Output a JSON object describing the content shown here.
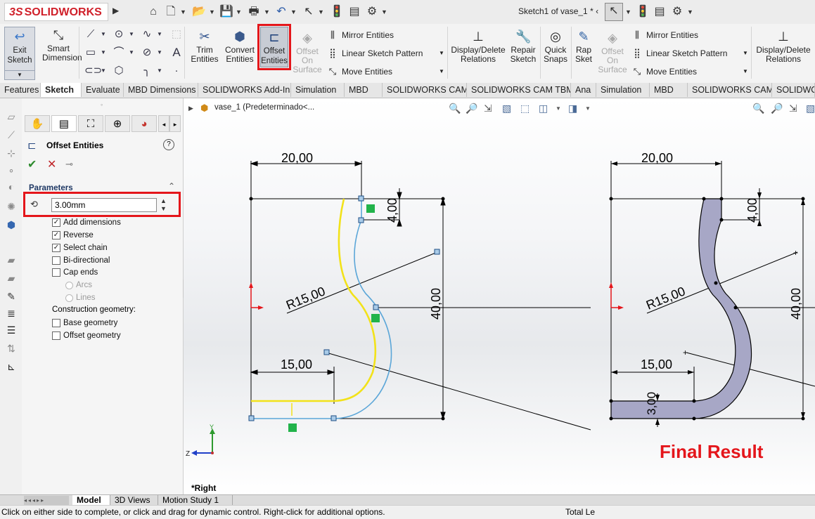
{
  "app": {
    "logo": "SOLIDWORKS",
    "logo_prefix": "3S",
    "document_title": "Sketch1 of vase_1 * ‹"
  },
  "ribbon": {
    "exit_sketch": "Exit\nSketch",
    "smart_dimension": "Smart\nDimension",
    "trim_entities": "Trim\nEntities",
    "convert_entities": "Convert\nEntities",
    "offset_entities": "Offset\nEntities",
    "offset_on_surface": "Offset\nOn\nSurface",
    "mirror_entities": "Mirror Entities",
    "linear_sketch_pattern": "Linear Sketch Pattern",
    "move_entities": "Move Entities",
    "display_delete_relations": "Display/Delete\nRelations",
    "repair_sketch": "Repair\nSketch",
    "quick_snaps": "Quick\nSnaps",
    "rapid_sketch": "Rap\nSket",
    "offset_on_surface_2": "Offset\nOn\nSurface",
    "mirror_entities_2": "Mirror Entities",
    "linear_sketch_pattern_2": "Linear Sketch Pattern",
    "move_entities_2": "Move Entities",
    "display_delete_relations_2": "Display/Delete\nRelations"
  },
  "tabs": [
    "Features",
    "Sketch",
    "Evaluate",
    "MBD Dimensions",
    "SOLIDWORKS Add-Ins",
    "Simulation",
    "MBD",
    "SOLIDWORKS CAM",
    "SOLIDWORKS CAM TBM",
    "Ana",
    "Simulation",
    "MBD",
    "SOLIDWORKS CAM",
    "SOLIDWO"
  ],
  "active_tab": "Sketch",
  "property_manager": {
    "title": "Offset Entities",
    "section": "Parameters",
    "offset_value": "3.00mm",
    "options": [
      {
        "label": "Add dimensions",
        "checked": true
      },
      {
        "label": "Reverse",
        "checked": true
      },
      {
        "label": "Select chain",
        "checked": true
      },
      {
        "label": "Bi-directional",
        "checked": false
      },
      {
        "label": "Cap ends",
        "checked": false
      }
    ],
    "cap_types": [
      "Arcs",
      "Lines"
    ],
    "construction_label": "Construction geometry:",
    "construction": [
      {
        "label": "Base geometry",
        "checked": false
      },
      {
        "label": "Offset geometry",
        "checked": false
      }
    ]
  },
  "graphics": {
    "tree_item": "vase_1  (Predeterminado<...",
    "view_label": "*Right",
    "left_sketch": {
      "dim_top": "20,00",
      "dim_small": "4,00",
      "dim_radius": "R15,00",
      "dim_height": "40,00",
      "dim_bottom": "15,00"
    },
    "right_sketch": {
      "dim_top": "20,00",
      "dim_small": "4,00",
      "dim_radius": "R15,00",
      "dim_height": "40,00",
      "dim_bottom": "15,00",
      "dim_thickness": "3,00"
    },
    "result_label": "Final Result",
    "axis_y": "Y",
    "axis_z": "Z"
  },
  "bottom_tabs": [
    "Model",
    "3D Views",
    "Motion Study 1"
  ],
  "status": {
    "message": "Click on either side to complete, or click and drag for dynamic control.  Right-click for additional options.",
    "right": "Total Le"
  },
  "colors": {
    "highlight": "#e4161b",
    "result_fill": "#a7a7c6",
    "offset_line": "#f2e21a",
    "base_line": "#5ba6d8",
    "accent": "#cc1f1a"
  }
}
